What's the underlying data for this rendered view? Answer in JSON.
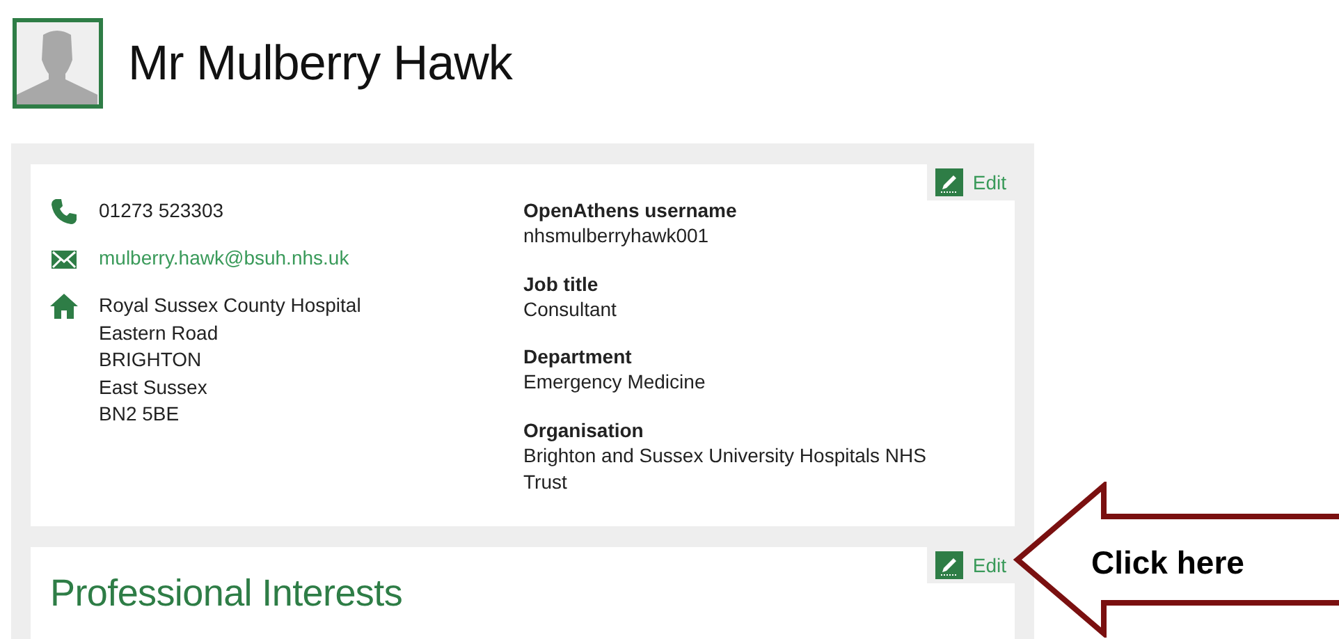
{
  "profile": {
    "name": "Mr Mulberry Hawk"
  },
  "contact": {
    "edit_label": "Edit",
    "phone": "01273 523303",
    "email": "mulberry.hawk@bsuh.nhs.uk",
    "address": [
      "Royal Sussex County Hospital",
      "Eastern Road",
      "BRIGHTON",
      "East Sussex",
      "BN2 5BE"
    ]
  },
  "details": [
    {
      "label": "OpenAthens username",
      "value": "nhsmulberryhawk001"
    },
    {
      "label": "Job title",
      "value": "Consultant"
    },
    {
      "label": "Department",
      "value": "Emergency Medicine"
    },
    {
      "label": "Organisation",
      "value": "Brighton and Sussex University Hospitals NHS Trust"
    }
  ],
  "sections": [
    {
      "title": "Professional Interests",
      "edit_label": "Edit"
    }
  ],
  "callout": {
    "text": "Click here"
  }
}
